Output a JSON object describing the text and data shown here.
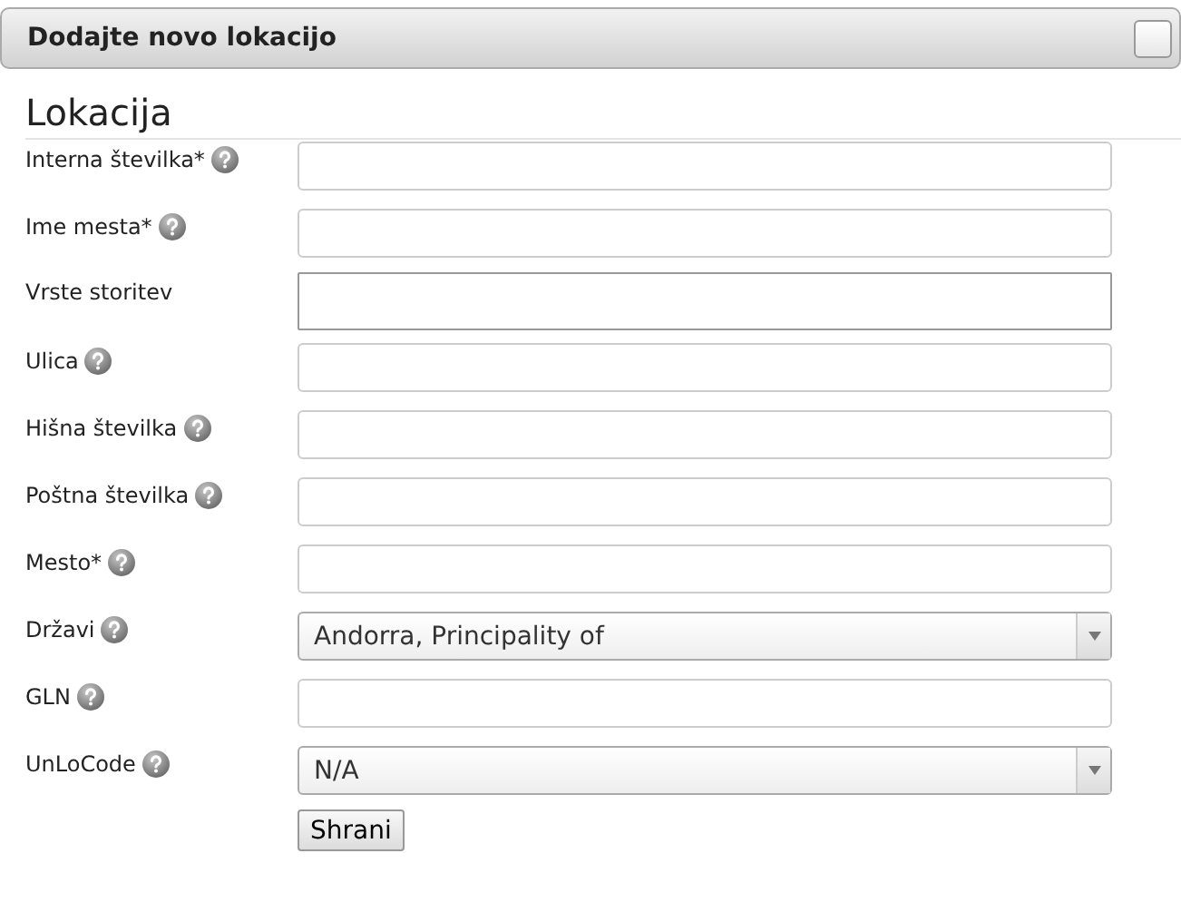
{
  "panel": {
    "title": "Dodajte novo lokacijo"
  },
  "section": {
    "title": "Lokacija"
  },
  "fields": [
    {
      "label": "Interna številka*",
      "help": true,
      "kind": "text"
    },
    {
      "label": "Ime mesta*",
      "help": true,
      "kind": "text"
    },
    {
      "label": "Vrste storitev",
      "help": false,
      "kind": "multi"
    },
    {
      "label": "Ulica",
      "help": true,
      "kind": "text"
    },
    {
      "label": "Hišna številka",
      "help": true,
      "kind": "text"
    },
    {
      "label": "Poštna številka",
      "help": true,
      "kind": "text"
    },
    {
      "label": "Mesto*",
      "help": true,
      "kind": "text"
    },
    {
      "label": "Državi",
      "help": true,
      "kind": "select",
      "value": "Andorra, Principality of"
    },
    {
      "label": "GLN",
      "help": true,
      "kind": "text"
    },
    {
      "label": "UnLoCode",
      "help": true,
      "kind": "select",
      "value": "N/A"
    }
  ],
  "submit": {
    "label": "Shrani"
  }
}
